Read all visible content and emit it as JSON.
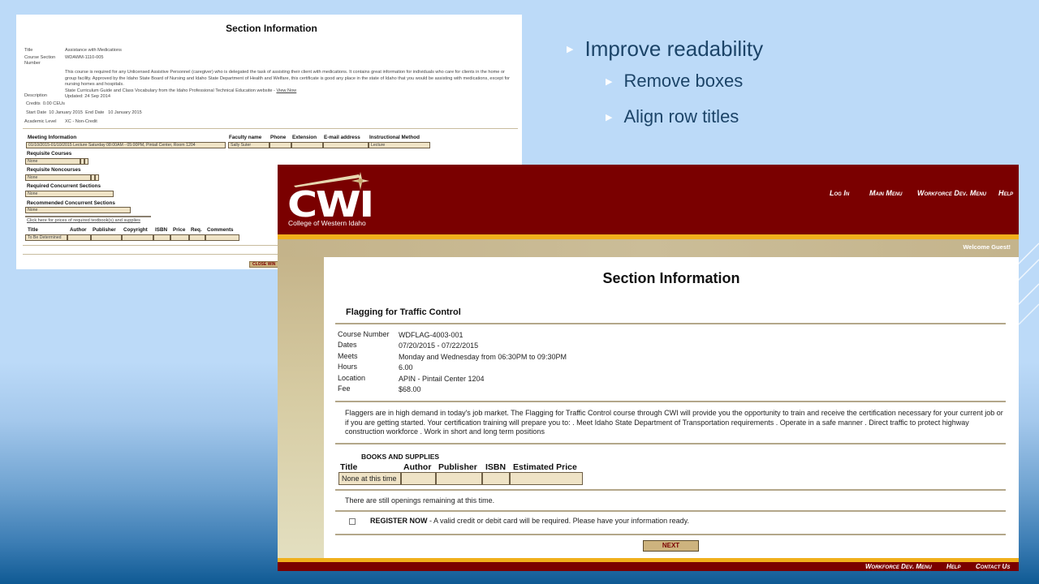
{
  "slide": {
    "bullets": [
      {
        "level": 1,
        "text": "Improve readability"
      },
      {
        "level": 2,
        "text": "Remove boxes"
      },
      {
        "level": 2,
        "text": "Align row titles"
      }
    ]
  },
  "old_page": {
    "title": "Section Information",
    "fields": {
      "title_label": "Title",
      "title_value": "Assistance with Medications",
      "section_label": "Course Section",
      "section_label2": "Number",
      "section_value": "WDAWM-1110-005",
      "description_label": "Description",
      "description_text": "This course is required for any Unlicensed Assistive Personnel (caregiver) who is delegated the task of assisting their client with medications. It contains great information for individuals who care for clients in the home or group facility. Approved by the Idaho State Board of Nursing and Idaho State Department of Health and Welfare, this certificate is good any place in the state of Idaho that you would be assisting with medications, except for nursing homes and hospitals.",
      "curriculum_text": "State Curriculum Guide and Class Vocabulary from the Idaho Professional Technical Education website - ",
      "view_now_link": "View Now",
      "updated": "Updated: 24 Sep 2014",
      "credits_label": "Credits",
      "credits_value": "0.00",
      "credits_unit": "CEUs",
      "start_label": "Start Date",
      "start_value": "10 January 2015",
      "end_label": "End Date",
      "end_value": "10 January 2015",
      "academic_label": "Academic Level",
      "academic_value": "XC - Non-Credit"
    },
    "meeting": {
      "header": "Meeting Information",
      "value": "01/10/2015-01/10/2015 Lecture Saturday 08:00AM - 05:00PM, Pintail Center, Room 1204",
      "columns": [
        "Faculty name",
        "Phone",
        "Extension",
        "E-mail address",
        "Instructional Method"
      ],
      "row": [
        "Sally Suter",
        "",
        "",
        "",
        "Lecture"
      ]
    },
    "requisite_courses": {
      "header": "Requisite Courses",
      "value": "None"
    },
    "requisite_noncourses": {
      "header": "Requisite Noncourses",
      "value": "None"
    },
    "required_concurrent": {
      "header": "Required Concurrent Sections",
      "value": "None"
    },
    "recommended_concurrent": {
      "header": "Recommended Concurrent Sections",
      "value": "None"
    },
    "textbook_link": "Click here for prices of required textbook(s) and supplies",
    "books": {
      "columns": [
        "Title",
        "Author",
        "Publisher",
        "Copyright",
        "ISBN",
        "Price",
        "Req.",
        "Comments"
      ],
      "row": [
        "To Be Determined",
        "",
        "",
        "",
        "",
        "",
        "",
        ""
      ]
    },
    "close_button": "CLOSE WIN"
  },
  "cwi_page": {
    "logo_text": "CWI",
    "logo_subtitle": "College of Western Idaho",
    "nav": [
      "Log In",
      "Main Menu",
      "Workforce Dev. Menu",
      "Help"
    ],
    "welcome": "Welcome Guest!",
    "title": "Section Information",
    "course_name": "Flagging for Traffic Control",
    "details": [
      {
        "label": "Course Number",
        "value": "WDFLAG-4003-001"
      },
      {
        "label": "Dates",
        "value": "07/20/2015 - 07/22/2015"
      },
      {
        "label": "Meets",
        "value": "Monday and Wednesday from 06:30PM to 09:30PM"
      },
      {
        "label": "Hours",
        "value": "6.00"
      },
      {
        "label": "Location",
        "value": "APIN - Pintail Center 1204"
      },
      {
        "label": "Fee",
        "value": "$68.00"
      }
    ],
    "description": "Flaggers are in high demand in today's job market. The Flagging for Traffic Control course through CWI will provide you the opportunity to train and receive the certification necessary for your current job or if you are getting started. Your certification training will prepare you to: . Meet Idaho State Department of Transportation requirements . Operate in a safe manner . Direct traffic to protect highway construction workforce . Work in short and long term positions",
    "books_header": "BOOKS AND SUPPLIES",
    "books_columns": [
      "Title",
      "Author",
      "Publisher",
      "ISBN",
      "Estimated Price"
    ],
    "books_row": [
      "None at this time",
      "",
      "",
      "",
      ""
    ],
    "openings": "There are still openings remaining at this time.",
    "register_bold": "REGISTER NOW",
    "register_text": " - A valid credit or debit card will be required. Please have your information ready.",
    "register_checked": false,
    "next_button": "NEXT",
    "footer_nav": [
      "Workforce Dev. Menu",
      "Help",
      "Contact Us"
    ],
    "colors": {
      "maroon": "#7a0000",
      "gold": "#f0b01c",
      "tan": "#c5b48c",
      "cell": "#efe3c6"
    }
  }
}
